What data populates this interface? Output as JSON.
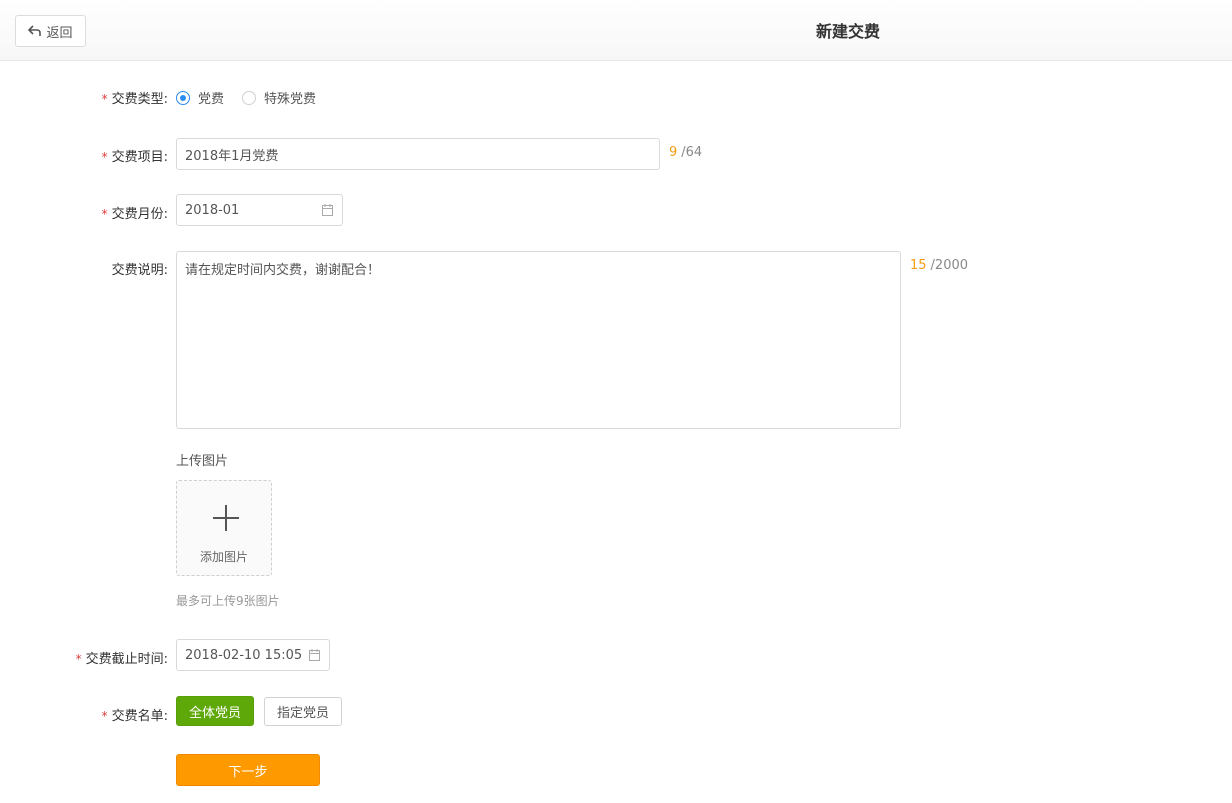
{
  "header": {
    "back_label": "返回",
    "title": "新建交费"
  },
  "form": {
    "type": {
      "label": "交费类型",
      "options": [
        "党费",
        "特殊党费"
      ],
      "selected": "党费"
    },
    "project": {
      "label": "交费项目",
      "value": "2018年1月党费",
      "count": "9",
      "max": "/64"
    },
    "month": {
      "label": "交费月份",
      "value": "2018-01"
    },
    "description": {
      "label": "交费说明",
      "value": "请在规定时间内交费，谢谢配合！",
      "count": "15",
      "max": "/2000"
    },
    "upload": {
      "label": "上传图片",
      "add_text": "添加图片",
      "hint": "最多可上传9张图片"
    },
    "deadline": {
      "label": "交费截止时间",
      "value": "2018-02-10 15:05"
    },
    "roster": {
      "label": "交费名单",
      "all_label": "全体党员",
      "specific_label": "指定党员"
    },
    "next_label": "下一步"
  },
  "colors": {
    "required": "#e23b3b",
    "radio_accent": "#2d8cf0",
    "counter": "#f39c12",
    "green": "#5fa80a",
    "orange": "#ff9900"
  },
  "icons": {
    "back": "back-arrow-icon",
    "calendar": "calendar-icon",
    "add": "plus-icon"
  }
}
